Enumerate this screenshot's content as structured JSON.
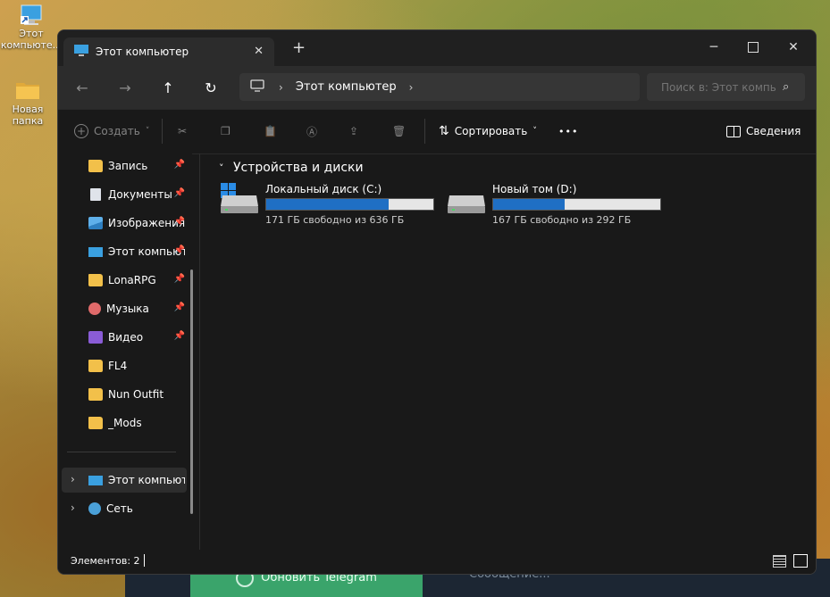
{
  "desktop": {
    "icons": [
      {
        "label": "Этот\nкомпьюте...",
        "icon": "computer-shortcut-icon"
      },
      {
        "label": "Новая папка",
        "icon": "folder-icon"
      }
    ],
    "telegram": {
      "update_label": "Обновить Telegram",
      "message_placeholder": "Сообщение..."
    }
  },
  "window": {
    "tab_title": "Этот компьютер",
    "address_crumb": "Этот компьютер",
    "search_placeholder": "Поиск в: Этот компьютер",
    "toolbar": {
      "create_label": "Создать",
      "sort_label": "Сортировать",
      "more_label": "•••",
      "details_label": "Сведения"
    },
    "sidebar": {
      "pinned": [
        {
          "label": "Запись",
          "icon": "folder-icon"
        },
        {
          "label": "Документы",
          "icon": "documents-icon"
        },
        {
          "label": "Изображения",
          "icon": "pictures-icon"
        },
        {
          "label": "Этот компьютер",
          "icon": "computer-icon"
        },
        {
          "label": "LonaRPG",
          "icon": "folder-icon"
        },
        {
          "label": "Музыка",
          "icon": "music-icon"
        },
        {
          "label": "Видео",
          "icon": "video-icon"
        },
        {
          "label": "FL4",
          "icon": "folder-icon"
        },
        {
          "label": "Nun Outfit",
          "icon": "folder-icon"
        },
        {
          "label": "_Mods",
          "icon": "folder-icon"
        }
      ],
      "roots": [
        {
          "label": "Этот компьютер",
          "icon": "computer-icon",
          "selected": true
        },
        {
          "label": "Сеть",
          "icon": "network-icon",
          "selected": false
        }
      ]
    },
    "group_title": "Устройства и диски",
    "drives": [
      {
        "name": "Локальный диск (C:)",
        "free_text": "171 ГБ свободно из 636 ГБ",
        "used_fraction": 0.731,
        "system": true
      },
      {
        "name": "Новый том (D:)",
        "free_text": "167 ГБ свободно из 292 ГБ",
        "used_fraction": 0.428,
        "system": false
      }
    ],
    "status": {
      "count_text": "Элементов: 2"
    }
  },
  "colors": {
    "accent": "#1f6fc4",
    "window_bg": "#191919",
    "folder": "#f2c04a"
  }
}
